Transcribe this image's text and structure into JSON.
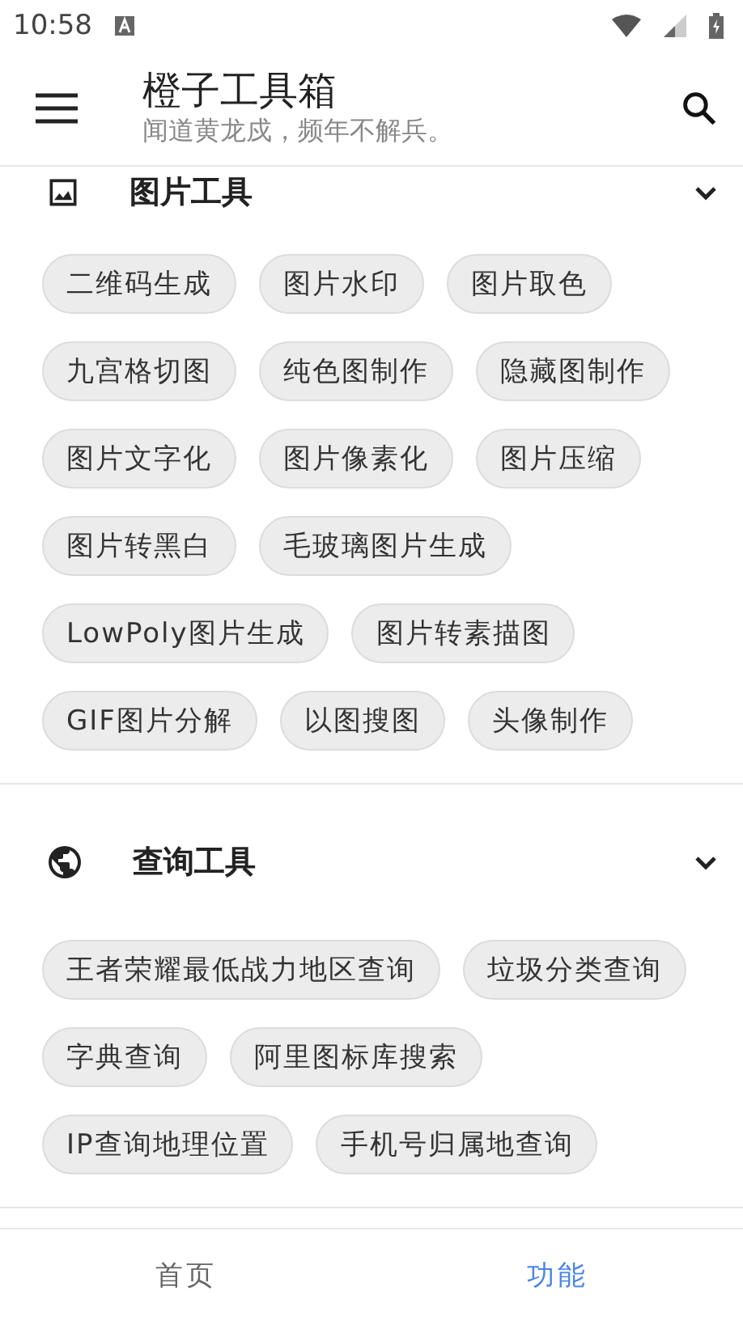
{
  "status_bar": {
    "time": "10:58"
  },
  "app_bar": {
    "title": "橙子工具箱",
    "subtitle": "闻道黄龙戍，频年不解兵。"
  },
  "sections": [
    {
      "kind": "image",
      "title": "图片工具",
      "expanded": true,
      "chips": [
        "二维码生成",
        "图片水印",
        "图片取色",
        "九宫格切图",
        "纯色图制作",
        "隐藏图制作",
        "图片文字化",
        "图片像素化",
        "图片压缩",
        "图片转黑白",
        "毛玻璃图片生成",
        "LowPoly图片生成",
        "图片转素描图",
        "GIF图片分解",
        "以图搜图",
        "头像制作"
      ]
    },
    {
      "kind": "globe",
      "title": "查询工具",
      "expanded": true,
      "chips": [
        "王者荣耀最低战力地区查询",
        "垃圾分类查询",
        "字典查询",
        "阿里图标库搜索",
        "IP查询地理位置",
        "手机号归属地查询"
      ]
    }
  ],
  "bottom_nav": [
    {
      "label": "首页",
      "selected": false
    },
    {
      "label": "功能",
      "selected": true
    }
  ]
}
